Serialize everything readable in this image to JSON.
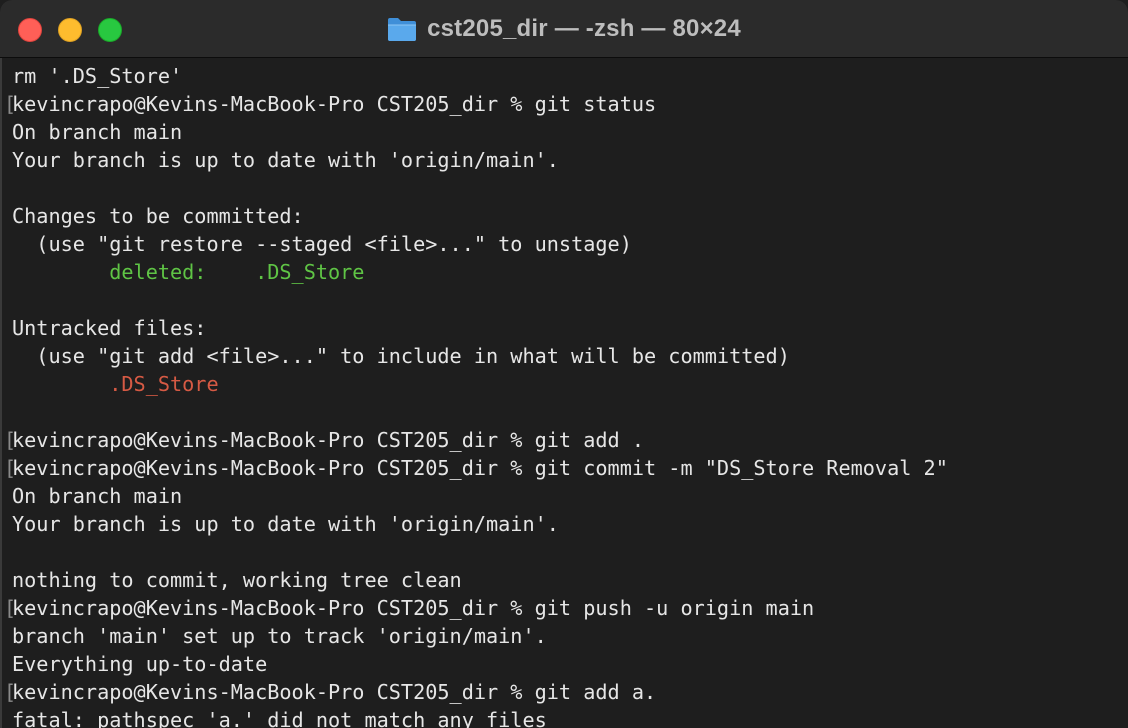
{
  "window": {
    "title": "cst205_dir — -zsh — 80×24",
    "icon": "folder-icon",
    "colors": {
      "close": "#ff5f57",
      "minimize": "#febc2e",
      "zoom": "#28c840",
      "staged_file": "#5fc445",
      "untracked_file": "#d65a44"
    }
  },
  "terminal": {
    "lines": [
      {
        "text": "rm '.DS_Store'",
        "prompt": false
      },
      {
        "text": "kevincrapo@Kevins-MacBook-Pro CST205_dir % git status",
        "prompt": true
      },
      {
        "text": "On branch main",
        "prompt": false
      },
      {
        "text": "Your branch is up to date with 'origin/main'.",
        "prompt": false
      },
      {
        "text": "",
        "prompt": false
      },
      {
        "text": "Changes to be committed:",
        "prompt": false
      },
      {
        "text": "  (use \"git restore --staged <file>...\" to unstage)",
        "prompt": false
      },
      {
        "text": "        deleted:    .DS_Store",
        "prompt": false,
        "color": "staged"
      },
      {
        "text": "",
        "prompt": false
      },
      {
        "text": "Untracked files:",
        "prompt": false
      },
      {
        "text": "  (use \"git add <file>...\" to include in what will be committed)",
        "prompt": false
      },
      {
        "text": "        .DS_Store",
        "prompt": false,
        "color": "untracked"
      },
      {
        "text": "",
        "prompt": false
      },
      {
        "text": "kevincrapo@Kevins-MacBook-Pro CST205_dir % git add .",
        "prompt": true
      },
      {
        "text": "kevincrapo@Kevins-MacBook-Pro CST205_dir % git commit -m \"DS_Store Removal 2\"",
        "prompt": true
      },
      {
        "text": "On branch main",
        "prompt": false
      },
      {
        "text": "Your branch is up to date with 'origin/main'.",
        "prompt": false
      },
      {
        "text": "",
        "prompt": false
      },
      {
        "text": "nothing to commit, working tree clean",
        "prompt": false
      },
      {
        "text": "kevincrapo@Kevins-MacBook-Pro CST205_dir % git push -u origin main",
        "prompt": true
      },
      {
        "text": "branch 'main' set up to track 'origin/main'.",
        "prompt": false
      },
      {
        "text": "Everything up-to-date",
        "prompt": false
      },
      {
        "text": "kevincrapo@Kevins-MacBook-Pro CST205_dir % git add a.",
        "prompt": true
      },
      {
        "text": "fatal: pathspec 'a.' did not match any files",
        "prompt": false
      }
    ]
  }
}
